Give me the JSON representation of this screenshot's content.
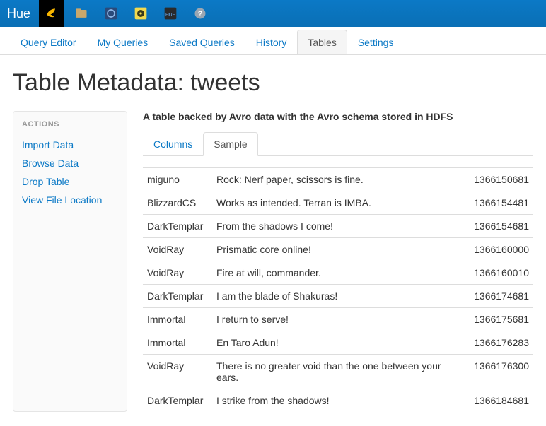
{
  "brand": "Hue",
  "nav": {
    "items": [
      "Query Editor",
      "My Queries",
      "Saved Queries",
      "History",
      "Tables",
      "Settings"
    ],
    "active": 4
  },
  "page_title": "Table Metadata: tweets",
  "sidebar": {
    "heading": "ACTIONS",
    "actions": [
      "Import Data",
      "Browse Data",
      "Drop Table",
      "View File Location"
    ]
  },
  "description": "A table backed by Avro data with the Avro schema stored in HDFS",
  "subtabs": {
    "items": [
      "Columns",
      "Sample"
    ],
    "active": 1
  },
  "rows": [
    {
      "user": "miguno",
      "text": "Rock: Nerf paper, scissors is fine.",
      "ts": "1366150681"
    },
    {
      "user": "BlizzardCS",
      "text": "Works as intended. Terran is IMBA.",
      "ts": "1366154481"
    },
    {
      "user": "DarkTemplar",
      "text": "From the shadows I come!",
      "ts": "1366154681"
    },
    {
      "user": "VoidRay",
      "text": "Prismatic core online!",
      "ts": "1366160000"
    },
    {
      "user": "VoidRay",
      "text": "Fire at will, commander.",
      "ts": "1366160010"
    },
    {
      "user": "DarkTemplar",
      "text": "I am the blade of Shakuras!",
      "ts": "1366174681"
    },
    {
      "user": "Immortal",
      "text": "I return to serve!",
      "ts": "1366175681"
    },
    {
      "user": "Immortal",
      "text": "En Taro Adun!",
      "ts": "1366176283"
    },
    {
      "user": "VoidRay",
      "text": "There is no greater void than the one between your ears.",
      "ts": "1366176300"
    },
    {
      "user": "DarkTemplar",
      "text": "I strike from the shadows!",
      "ts": "1366184681"
    }
  ]
}
